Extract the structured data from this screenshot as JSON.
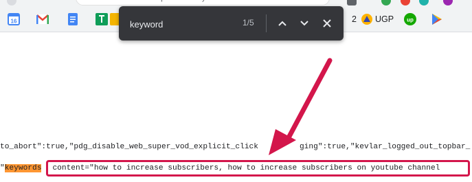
{
  "omnibox": {
    "url": "view-source:https://www.youtube.com/watch?v=..."
  },
  "bookmarks": [
    {
      "name": "calendar",
      "label": "16",
      "color": "#4285f4"
    },
    {
      "name": "gmail",
      "label": "M",
      "color": "#ea4335"
    },
    {
      "name": "docs",
      "label": "",
      "color": "#4285f4"
    },
    {
      "name": "sheets",
      "label": "",
      "color": "#0f9d58"
    },
    {
      "name": "slides",
      "label": "",
      "color": "#f4b400"
    }
  ],
  "bookmark_labels": {
    "partial_2": "2",
    "ugp": "UGP"
  },
  "findbar": {
    "query": "keyword",
    "count": "1/5",
    "prev_icon": "chevron-up-icon",
    "next_icon": "chevron-down-icon",
    "close_icon": "close-icon"
  },
  "source": {
    "line1_a": "to_abort\":true,\"pdg_disable_web_super_vod_explicit_click",
    "line1_b": "ging\":true,\"kevlar_logged_out_topbar_",
    "line2_prefix": "\"",
    "line2_match": "keywords",
    "line2_content": "content=\"how to increase subscribers, how to increase subscribers on youtube channel"
  },
  "colors": {
    "find_highlight": "#ff9632",
    "annotation": "#d3164b"
  }
}
